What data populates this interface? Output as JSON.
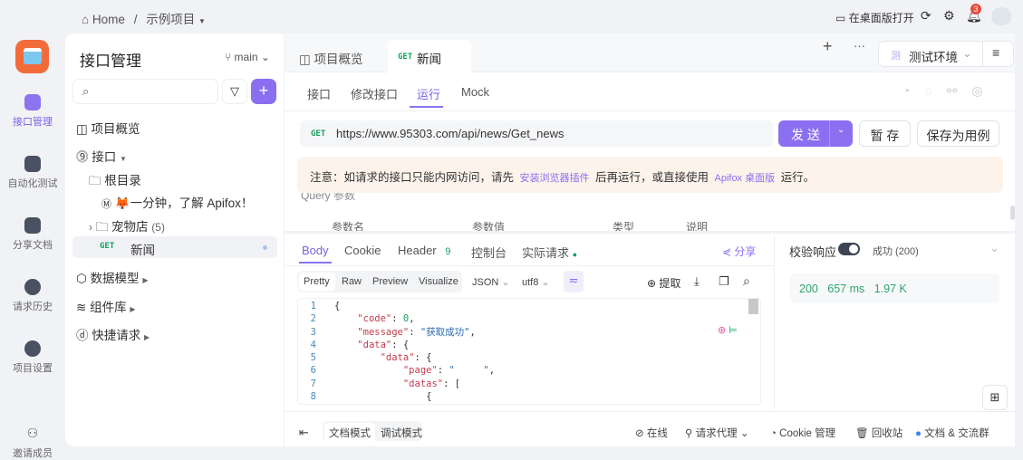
{
  "breadcrumb": {
    "home": "Home",
    "project": "示例项目"
  },
  "topbar": {
    "open_desktop": "在桌面版打开",
    "notifications": "3"
  },
  "nav": [
    {
      "label": "接口管理",
      "icon": "api-icon"
    },
    {
      "label": "自动化测试",
      "icon": "automation-icon"
    },
    {
      "label": "分享文档",
      "icon": "book-icon"
    },
    {
      "label": "请求历史",
      "icon": "clock-icon"
    },
    {
      "label": "项目设置",
      "icon": "settings-icon"
    },
    {
      "label": "邀请成员",
      "icon": "add-user-icon"
    }
  ],
  "sidebar": {
    "title": "接口管理",
    "branch": "main",
    "search_placeholder": "",
    "items": {
      "overview": "项目概览",
      "api": "接口",
      "root": "根目录",
      "intro": "🦊一分钟，了解 Apifox！",
      "petstore": "宠物店",
      "petstore_count": "(5)",
      "news_method": "GET",
      "news": "新闻",
      "models": "数据模型",
      "components": "组件库",
      "quick": "快捷请求"
    }
  },
  "tabs": {
    "overview": "项目概览",
    "active_method": "GET",
    "active": "新闻"
  },
  "env": {
    "badge": "测",
    "name": "测试环境"
  },
  "subtabs": [
    "接口",
    "修改接口",
    "运行",
    "Mock"
  ],
  "request": {
    "method": "GET",
    "url": "https://www.95303.com/api/news/Get_news",
    "send": "发 送",
    "save": "暂 存",
    "save_case": "保存为用例"
  },
  "notice": {
    "prefix": "注意：如请求的接口只能内网访问，请先",
    "link1": "安装浏览器插件",
    "middle": "后再运行，或直接使用",
    "link2": "Apifox 桌面版",
    "suffix": "运行。"
  },
  "params": {
    "section": "Query 参数",
    "cols": [
      "参数名",
      "参数值",
      "类型",
      "说明"
    ]
  },
  "response": {
    "tabs": [
      "Body",
      "Cookie",
      "Header",
      "控制台",
      "实际请求"
    ],
    "header_count": "9",
    "share": "分享",
    "formats": [
      "Pretty",
      "Raw",
      "Preview",
      "Visualize"
    ],
    "type": "JSON",
    "encoding": "utf8",
    "extract": "提取",
    "lines": [
      {
        "n": "1",
        "html": "{"
      },
      {
        "n": "2",
        "k": "\"code\"",
        "v": "0",
        "vt": "n",
        "end": ","
      },
      {
        "n": "3",
        "k": "\"message\"",
        "v": "\"获取成功\"",
        "vt": "s",
        "end": ","
      },
      {
        "n": "4",
        "k": "\"data\"",
        "v": "{",
        "vt": "p",
        "end": ""
      },
      {
        "n": "5",
        "k": "\"data\"",
        "v": "{",
        "vt": "p",
        "end": ""
      },
      {
        "n": "6",
        "k": "\"page\"",
        "v": "\"     \"",
        "vt": "s",
        "end": ","
      },
      {
        "n": "7",
        "k": "\"datas\"",
        "v": "[",
        "vt": "p",
        "end": ""
      },
      {
        "n": "8",
        "html": "{"
      }
    ]
  },
  "validate": {
    "label": "校验响应",
    "status": "成功 (200)",
    "code": "200",
    "time": "657 ms",
    "size": "1.97 K"
  },
  "footer": {
    "doc_mode": "文档模式",
    "debug_mode": "调试模式",
    "online": "在线",
    "proxy": "请求代理",
    "cookie": "Cookie 管理",
    "trash": "回收站",
    "community": "文档 & 交流群"
  }
}
